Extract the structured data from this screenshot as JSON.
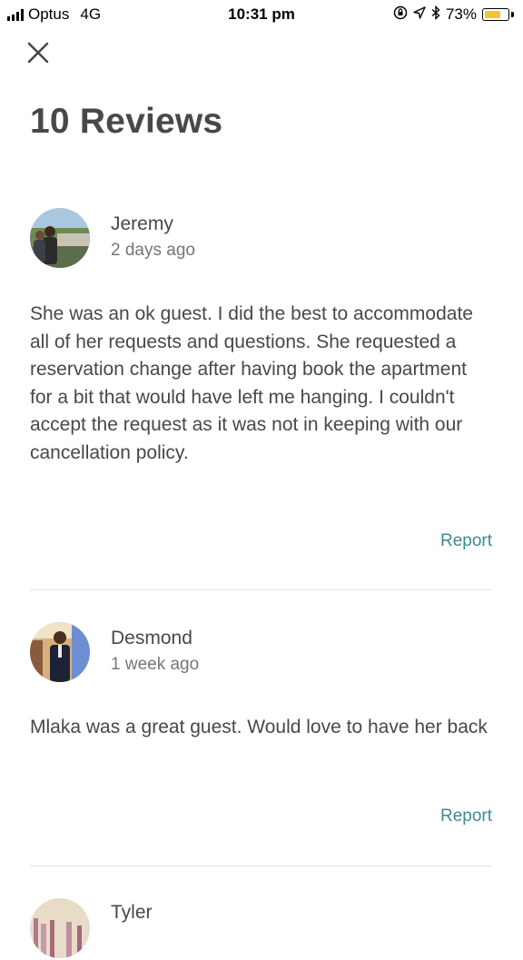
{
  "status_bar": {
    "carrier": "Optus",
    "network": "4G",
    "time": "10:31 pm",
    "battery": "73%",
    "battery_level": 0.73,
    "icons": [
      "lock-rotation-icon",
      "location-arrow-icon",
      "bluetooth-icon"
    ]
  },
  "header": {
    "close_icon": "close-icon",
    "title": "10 Reviews"
  },
  "reviews": [
    {
      "name": "Jeremy",
      "date": "2 days ago",
      "text": "She was an ok guest. I did the best to accommodate all of her requests and questions. She requested a reservation change after having book the apartment for a bit that would have left me hanging. I couldn't accept the request as it was not in keeping with our cancellation policy.",
      "report": "Report"
    },
    {
      "name": "Desmond",
      "date": "1 week ago",
      "text": "Mlaka was a great guest. Would love to have her back",
      "report": "Report"
    },
    {
      "name": "Tyler"
    }
  ],
  "colors": {
    "text": "#484848",
    "muted": "#767676",
    "link": "#3d8b8b",
    "battery": "#f4c430",
    "divider": "#e4e4e4"
  }
}
